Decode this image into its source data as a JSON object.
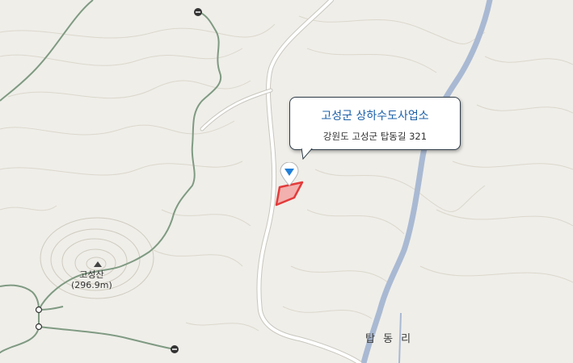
{
  "popup": {
    "title": "고성군 상하수도사업소",
    "address": "강원도 고성군 탑동길 321"
  },
  "places": {
    "village": "탑 동 리",
    "mountain_name": "고성산",
    "mountain_elevation": "(296.9m)"
  },
  "colors": {
    "background": "#efeee9",
    "river": "#a9b9d3",
    "road": "#ffffff",
    "road_casing": "#c8c6bd",
    "boundary": "#7f9a82",
    "contour": "#d9d6cc",
    "parcel_fill": "#f2b1ae",
    "parcel_stroke": "#e33b3b",
    "popup_title": "#1a5fa8",
    "pin": "#1f7fd8"
  },
  "icons": {
    "pin": "location-pin-icon",
    "mountain": "mountain-peak-icon",
    "junction": "boundary-point-icon"
  }
}
